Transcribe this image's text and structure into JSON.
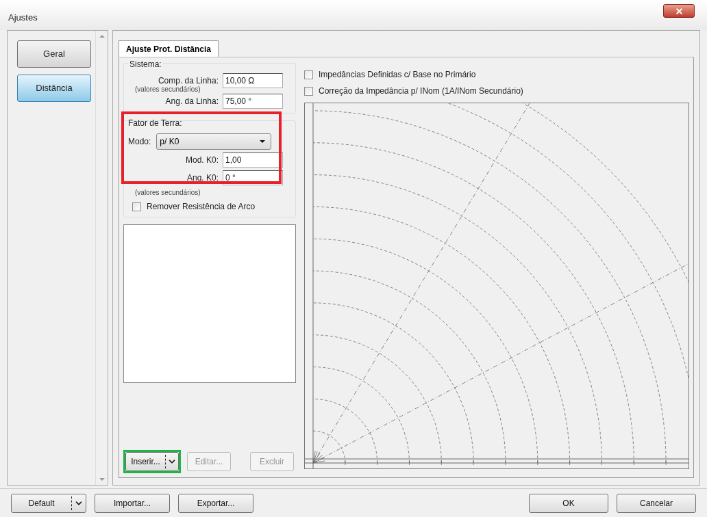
{
  "window": {
    "title": "Ajustes"
  },
  "sidebar": {
    "items": [
      {
        "label": "Geral",
        "selected": false
      },
      {
        "label": "Distância",
        "selected": true
      }
    ]
  },
  "tabs": [
    {
      "label": "Ajuste Prot. Distância",
      "selected": true
    }
  ],
  "sistema": {
    "title": "Sistema:",
    "fields": [
      {
        "label": "Comp. da Linha:",
        "value": "10,00 Ω",
        "note": "(valores secundários)"
      },
      {
        "label": "Ang. da Linha:",
        "value": "75,00 °"
      }
    ]
  },
  "fator_terra": {
    "title": "Fator de Terra:",
    "highlighted": true,
    "modo": {
      "label": "Modo:",
      "value": "p/ K0"
    },
    "fields": [
      {
        "label": "Mod. K0:",
        "value": "1,00"
      },
      {
        "label": "Ang. K0:",
        "value": "0 °"
      }
    ],
    "note": "(valores secundários)",
    "checkbox": {
      "label": "Remover Resistência de Arco",
      "checked": false
    }
  },
  "list_buttons": [
    {
      "label": "Inserir...",
      "split": true,
      "disabled": false,
      "highlighted": true
    },
    {
      "label": "Editar...",
      "split": false,
      "disabled": true,
      "highlighted": false
    },
    {
      "label": "Excluir",
      "split": false,
      "disabled": true,
      "highlighted": false
    }
  ],
  "options": [
    {
      "label": "Impedâncias Definidas c/ Base no Primário",
      "checked": false
    },
    {
      "label": "Correção da Impedância p/ INom (1A/INom Secundário)",
      "checked": false
    }
  ],
  "footer": {
    "left": [
      {
        "label": "Default",
        "split": true
      },
      {
        "label": "Importar...",
        "split": false
      },
      {
        "label": "Exportar...",
        "split": false
      }
    ],
    "right": [
      {
        "label": "OK",
        "split": false
      },
      {
        "label": "Cancelar",
        "split": false
      }
    ]
  }
}
